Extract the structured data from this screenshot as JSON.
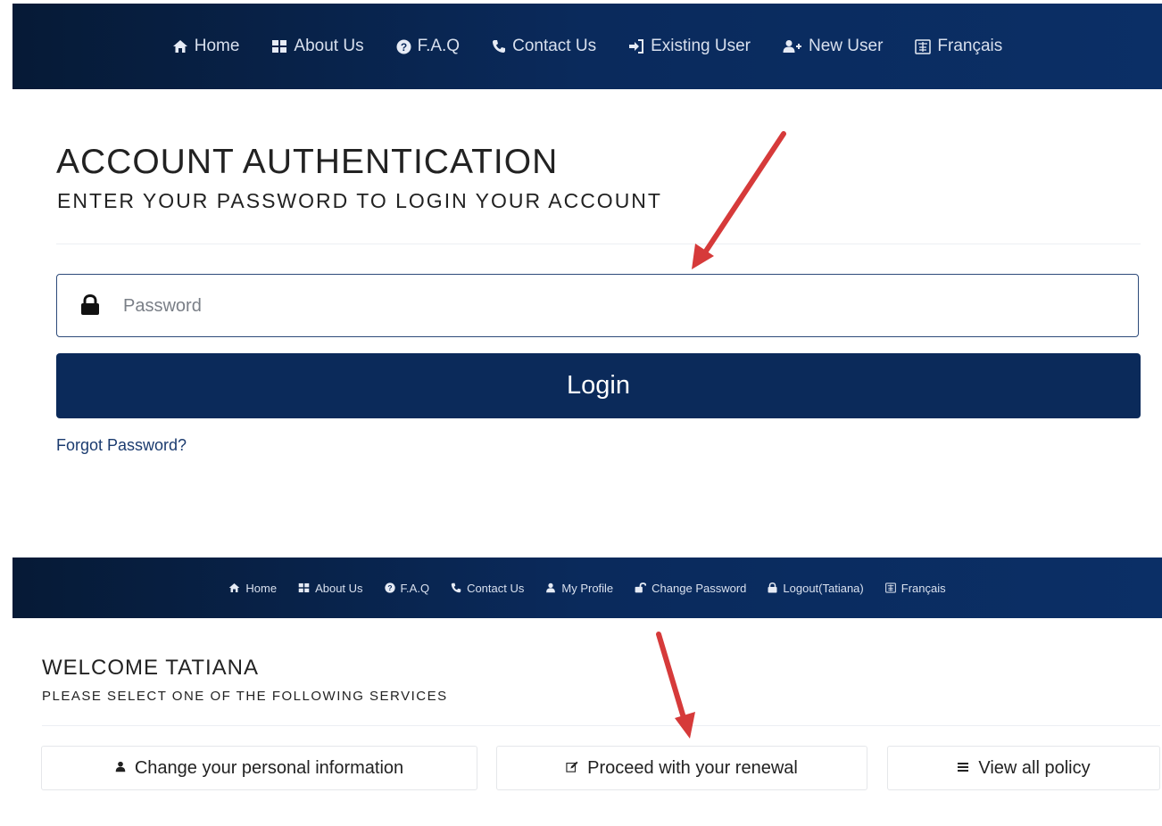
{
  "colors": {
    "nav_bg": "#0a2a5c",
    "button_bg": "#0b2a5a",
    "link": "#1b3b6f",
    "arrow": "#d63a3a"
  },
  "top_nav": {
    "items": [
      {
        "icon": "home-icon",
        "glyph": "🏠",
        "label": "Home"
      },
      {
        "icon": "grid-icon",
        "glyph": "▦",
        "label": "About Us"
      },
      {
        "icon": "question-icon",
        "glyph": "?",
        "label": "F.A.Q"
      },
      {
        "icon": "phone-icon",
        "glyph": "✆",
        "label": "Contact Us"
      },
      {
        "icon": "sign-in-icon",
        "glyph": "⇥",
        "label": "Existing User"
      },
      {
        "icon": "add-user-icon",
        "glyph": "👤",
        "label": "New User"
      },
      {
        "icon": "language-icon",
        "glyph": "文",
        "label": "Français"
      }
    ]
  },
  "auth": {
    "title": "ACCOUNT AUTHENTICATION",
    "subtitle": "ENTER YOUR PASSWORD TO LOGIN YOUR ACCOUNT",
    "password_placeholder": "Password",
    "password_value": "",
    "login_label": "Login",
    "forgot_label": "Forgot Password?"
  },
  "bottom_nav": {
    "items": [
      {
        "icon": "home-icon",
        "glyph": "🏠",
        "label": "Home"
      },
      {
        "icon": "grid-icon",
        "glyph": "▦",
        "label": "About Us"
      },
      {
        "icon": "question-icon",
        "glyph": "?",
        "label": "F.A.Q"
      },
      {
        "icon": "phone-icon",
        "glyph": "✆",
        "label": "Contact Us"
      },
      {
        "icon": "user-icon",
        "glyph": "👤",
        "label": "My Profile"
      },
      {
        "icon": "unlock-icon",
        "glyph": "🔓",
        "label": "Change Password"
      },
      {
        "icon": "lock-icon",
        "glyph": "🔒",
        "label": "Logout(Tatiana)"
      },
      {
        "icon": "language-icon",
        "glyph": "文",
        "label": "Français"
      }
    ]
  },
  "welcome": {
    "title": "WELCOME TATIANA",
    "subtitle": "PLEASE SELECT ONE OF THE FOLLOWING SERVICES"
  },
  "services": [
    {
      "icon": "user-icon",
      "glyph": "👤",
      "label": "Change your personal information"
    },
    {
      "icon": "edit-icon",
      "glyph": "✎",
      "label": "Proceed with your renewal"
    },
    {
      "icon": "list-icon",
      "glyph": "≡",
      "label": "View all policy"
    }
  ]
}
